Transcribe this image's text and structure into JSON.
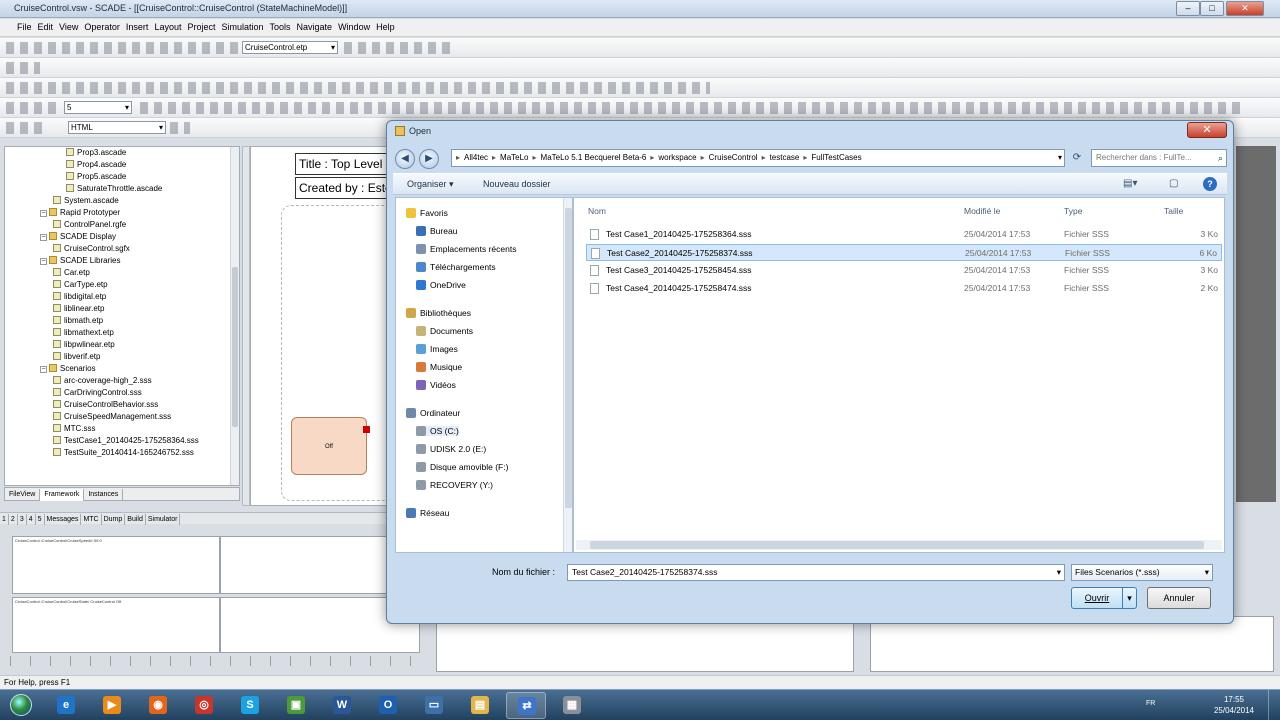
{
  "app": {
    "title": "CruiseControl.vsw - SCADE - [[CruiseControl::CruiseControl (StateMachineModel)]]",
    "menu": [
      "File",
      "Edit",
      "View",
      "Operator",
      "Insert",
      "Layout",
      "Project",
      "Simulation",
      "Tools",
      "Navigate",
      "Window",
      "Help"
    ],
    "toolbar_combo_1": "CruiseControl.etp",
    "toolbar_combo_2": "5",
    "toolbar_combo_3": "HTML",
    "status_text": "For Help, press F1"
  },
  "tree": {
    "items": [
      {
        "label": "Prop3.ascade",
        "indent": 5,
        "kind": "file"
      },
      {
        "label": "Prop4.ascade",
        "indent": 5,
        "kind": "file"
      },
      {
        "label": "Prop5.ascade",
        "indent": 5,
        "kind": "file"
      },
      {
        "label": "SaturateThrottle.ascade",
        "indent": 5,
        "kind": "file"
      },
      {
        "label": "System.ascade",
        "indent": 4,
        "kind": "file"
      },
      {
        "label": "Rapid Prototyper",
        "indent": 3,
        "kind": "folder"
      },
      {
        "label": "ControlPanel.rgfe",
        "indent": 4,
        "kind": "file"
      },
      {
        "label": "SCADE Display",
        "indent": 3,
        "kind": "folder"
      },
      {
        "label": "CruiseControl.sgfx",
        "indent": 4,
        "kind": "file"
      },
      {
        "label": "SCADE Libraries",
        "indent": 3,
        "kind": "folder"
      },
      {
        "label": "Car.etp",
        "indent": 4,
        "kind": "file"
      },
      {
        "label": "CarType.etp",
        "indent": 4,
        "kind": "file"
      },
      {
        "label": "libdigital.etp",
        "indent": 4,
        "kind": "file"
      },
      {
        "label": "liblinear.etp",
        "indent": 4,
        "kind": "file"
      },
      {
        "label": "libmath.etp",
        "indent": 4,
        "kind": "file"
      },
      {
        "label": "libmathext.etp",
        "indent": 4,
        "kind": "file"
      },
      {
        "label": "libpwlinear.etp",
        "indent": 4,
        "kind": "file"
      },
      {
        "label": "libverif.etp",
        "indent": 4,
        "kind": "file"
      },
      {
        "label": "Scenarios",
        "indent": 3,
        "kind": "folder"
      },
      {
        "label": "arc-coverage-high_2.sss",
        "indent": 4,
        "kind": "file"
      },
      {
        "label": "CarDrivingControl.sss",
        "indent": 4,
        "kind": "file"
      },
      {
        "label": "CruiseControlBehavior.sss",
        "indent": 4,
        "kind": "file"
      },
      {
        "label": "CruiseSpeedManagement.sss",
        "indent": 4,
        "kind": "file"
      },
      {
        "label": "MTC.sss",
        "indent": 4,
        "kind": "file"
      },
      {
        "label": "TestCase1_20140425-175258364.sss",
        "indent": 4,
        "kind": "file"
      },
      {
        "label": "TestSuite_20140414-165246752.sss",
        "indent": 4,
        "kind": "file"
      }
    ],
    "tabs": [
      "FileView",
      "Framework",
      "Instances"
    ]
  },
  "diagram": {
    "title_box": "Title : Top Level",
    "created_box": "Created by : Esterel",
    "state_label": "Off"
  },
  "bottom": {
    "tabs": [
      "1",
      "2",
      "3",
      "4",
      "5",
      "Messages",
      "MTC",
      "Dump",
      "Build",
      "Simulator"
    ],
    "pane1_label": "CruiseControl::CruiseControl/CruiseSpeed/r 59.0",
    "pane2_label": "CruiseControl::CruiseControl/CruiseState/ CruiseControl Off"
  },
  "dialog": {
    "title": "Open",
    "breadcrumb": [
      "All4tec",
      "MaTeLo",
      "MaTeLo 5.1 Becquerel Beta-6",
      "workspace",
      "CruiseControl",
      "testcase",
      "FullTestCases"
    ],
    "search_placeholder": "Rechercher dans : FullTe...",
    "organize": "Organiser ▾",
    "new_folder": "Nouveau dossier",
    "nav": {
      "favorites": "Favoris",
      "fav_items": [
        "Bureau",
        "Emplacements récents",
        "Téléchargements",
        "OneDrive"
      ],
      "libraries": "Bibliothèques",
      "lib_items": [
        "Documents",
        "Images",
        "Musique",
        "Vidéos"
      ],
      "computer": "Ordinateur",
      "comp_items": [
        "OS (C:)",
        "UDISK 2.0 (E:)",
        "Disque amovible (F:)",
        "RECOVERY (Y:)"
      ],
      "network": "Réseau"
    },
    "columns": {
      "name": "Nom",
      "modified": "Modifié le",
      "type": "Type",
      "size": "Taille"
    },
    "files": [
      {
        "name": "Test Case1_20140425-175258364.sss",
        "modified": "25/04/2014 17:53",
        "type": "Fichier SSS",
        "size": "3 Ko",
        "selected": false
      },
      {
        "name": "Test Case2_20140425-175258374.sss",
        "modified": "25/04/2014 17:53",
        "type": "Fichier SSS",
        "size": "6 Ko",
        "selected": true
      },
      {
        "name": "Test Case3_20140425-175258454.sss",
        "modified": "25/04/2014 17:53",
        "type": "Fichier SSS",
        "size": "3 Ko",
        "selected": false
      },
      {
        "name": "Test Case4_20140425-175258474.sss",
        "modified": "25/04/2014 17:53",
        "type": "Fichier SSS",
        "size": "2 Ko",
        "selected": false
      }
    ],
    "filename_label": "Nom du fichier :",
    "filename_value": "Test Case2_20140425-175258374.sss",
    "filter_value": "Files Scenarios (*.sss)",
    "open_label": "Ouvrir",
    "cancel_label": "Annuler"
  },
  "taskbar": {
    "lang": "FR",
    "time": "17:55",
    "date": "25/04/2014",
    "apps": [
      {
        "name": "internet-explorer",
        "color": "#1f74c8",
        "glyph": "e"
      },
      {
        "name": "media-player",
        "color": "#e98b1a",
        "glyph": "▶"
      },
      {
        "name": "firefox",
        "color": "#e0661c",
        "glyph": "◉"
      },
      {
        "name": "chrome",
        "color": "#c7352b",
        "glyph": "◎"
      },
      {
        "name": "skype",
        "color": "#1aa3e0",
        "glyph": "S"
      },
      {
        "name": "matelo",
        "color": "#4b9a3b",
        "glyph": "▣"
      },
      {
        "name": "word",
        "color": "#2b5797",
        "glyph": "W"
      },
      {
        "name": "outlook",
        "color": "#1f5fb0",
        "glyph": "O"
      },
      {
        "name": "remote-desktop",
        "color": "#3d6fa8",
        "glyph": "▭"
      },
      {
        "name": "explorer",
        "color": "#e2b64b",
        "glyph": "▤"
      },
      {
        "name": "scade",
        "color": "#3f75c8",
        "glyph": "⇄"
      },
      {
        "name": "calculator",
        "color": "#8a8f99",
        "glyph": "▦"
      }
    ]
  }
}
